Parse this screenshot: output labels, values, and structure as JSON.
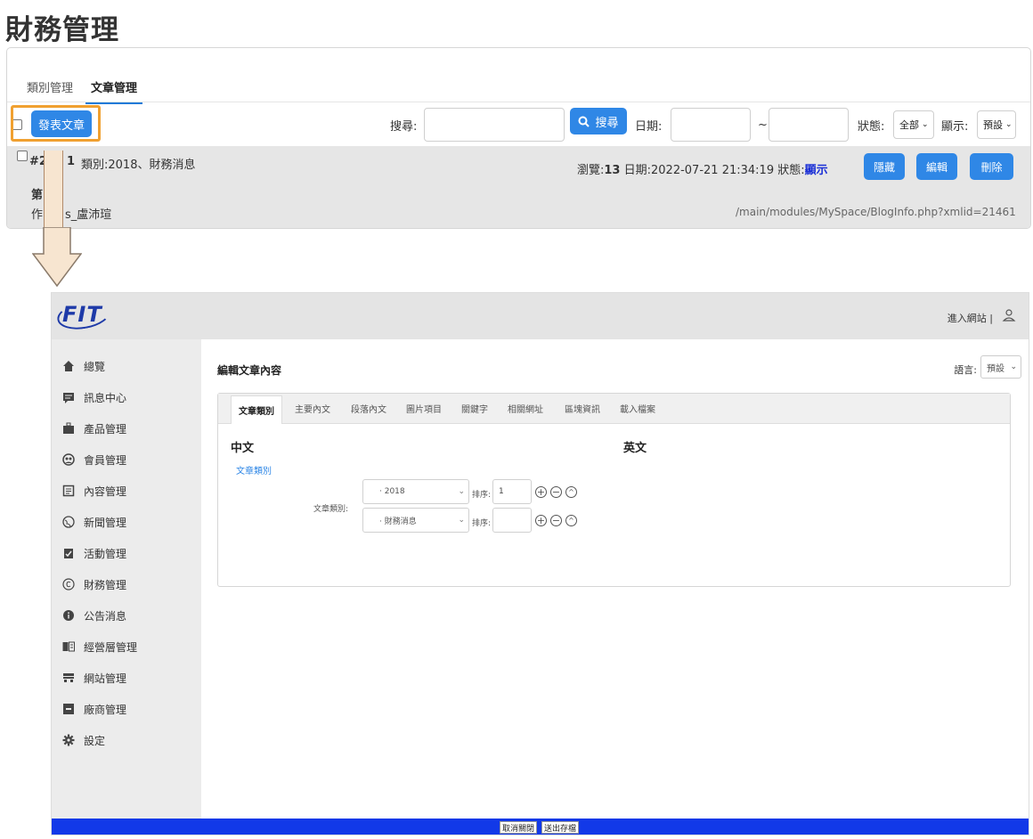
{
  "top": {
    "page_title": "財務管理",
    "tabs": [
      "類別管理",
      "文章管理"
    ],
    "active_tab": "文章管理",
    "post_button": "發表文章",
    "search_label": "搜尋:",
    "search_button": "搜尋",
    "date_label": "日期:",
    "date_sep": "~",
    "status_label": "狀態:",
    "status_value": "全部",
    "display_label": "顯示:",
    "display_value": "預設",
    "article": {
      "id_prefix": "#2",
      "id_suffix": "1",
      "category": "類別:2018、財務消息",
      "views_label": "瀏覽:",
      "views": "13",
      "date_label": "日期:",
      "date": "2022-07-21 21:34:19",
      "status_label": "狀態:",
      "status": "顯示",
      "title_partial": "第",
      "author_partial_a": "作",
      "author_partial_b": "s_盧沛瑄",
      "url": "/main/modules/MySpace/BlogInfo.php?xmlid=21461",
      "hide_button": "隱藏",
      "edit_button": "編輯",
      "delete_button": "刪除"
    }
  },
  "admin": {
    "logo": "FIT",
    "enter_site": "進入網站 |",
    "sidebar": [
      {
        "label": "總覽",
        "icon": "home-icon"
      },
      {
        "label": "訊息中心",
        "icon": "message-icon"
      },
      {
        "label": "產品管理",
        "icon": "briefcase-icon"
      },
      {
        "label": "會員管理",
        "icon": "members-icon"
      },
      {
        "label": "內容管理",
        "icon": "document-icon"
      },
      {
        "label": "新聞管理",
        "icon": "globe-icon"
      },
      {
        "label": "活動管理",
        "icon": "clipboard-icon"
      },
      {
        "label": "財務管理",
        "icon": "copyright-icon"
      },
      {
        "label": "公告消息",
        "icon": "info-icon"
      },
      {
        "label": "經營層管理",
        "icon": "book-icon"
      },
      {
        "label": "網站管理",
        "icon": "website-icon"
      },
      {
        "label": "廠商管理",
        "icon": "archive-icon"
      },
      {
        "label": "設定",
        "icon": "gear-icon"
      }
    ],
    "main_title": "編輯文章內容",
    "language_label": "語言:",
    "language_value": "預設",
    "edit_tabs": [
      "文章類別",
      "主要內文",
      "段落內文",
      "圖片項目",
      "關鍵字",
      "相關網址",
      "區塊資訊",
      "載入檔案"
    ],
    "chinese_title": "中文",
    "english_title": "英文",
    "category_link": "文章類別",
    "category_field_label": "文章類別:",
    "categories": [
      {
        "value": "· 2018",
        "order_label": "排序:",
        "order": "1"
      },
      {
        "value": "· 財務消息",
        "order_label": "排序:",
        "order": ""
      }
    ],
    "cancel_button": "取消關閉",
    "save_button": "送出存檔"
  }
}
